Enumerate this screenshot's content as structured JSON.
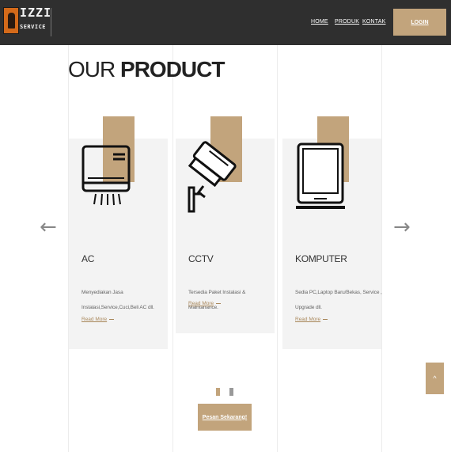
{
  "header": {
    "logo_line1": "IZZI",
    "logo_line2": "SERVICE",
    "nav": [
      "HOME",
      "PRODUK",
      "KONTAK"
    ],
    "login_label": "LOGIN"
  },
  "section": {
    "title_light": "OUR",
    "title_bold": "PRODUCT"
  },
  "products": [
    {
      "title": "AC",
      "desc_line1": "Menyediakan Jasa",
      "desc_line2": "Instalasi,Service,Cuci,Beli AC dll.",
      "read_more": "Read More",
      "icon": "air-conditioner-icon"
    },
    {
      "title": "CCTV",
      "desc_line1": "Tersedia Paket Instalasi & Maintanance.",
      "desc_line2": "",
      "read_more": "Read More",
      "icon": "cctv-camera-icon"
    },
    {
      "title": "KOMPUTER",
      "desc_line1": "Sedia PC,Laptop Baru/Bekas, Service ,",
      "desc_line2": "Upgrade dll.",
      "read_more": "Read More",
      "icon": "laptop-icon"
    }
  ],
  "carousel": {
    "prev_icon": "arrow-left-icon",
    "next_icon": "arrow-right-icon",
    "active_index": 1,
    "dot_count": 2
  },
  "cta_label": "Pesan Sekarang!",
  "back_to_top_label": "^",
  "colors": {
    "header_bg": "#2f2f2f",
    "accent": "#c2a47c",
    "card_bg": "#f3f3f3"
  }
}
